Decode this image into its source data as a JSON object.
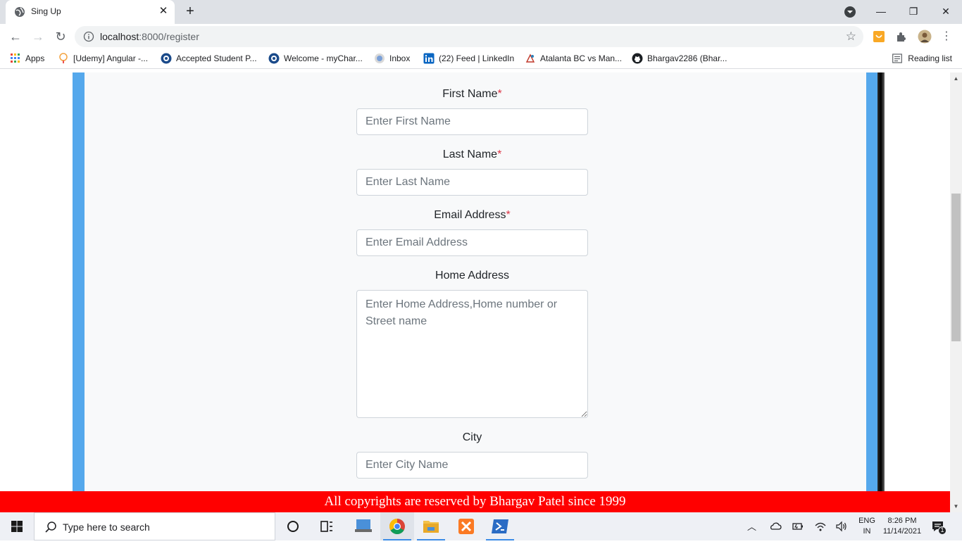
{
  "browser": {
    "tab_title": "Sing Up",
    "url_host": "localhost",
    "url_rest": ":8000/register",
    "bookmarks": [
      {
        "label": "Apps",
        "icon": "apps-grid-icon"
      },
      {
        "label": "[Udemy] Angular -...",
        "icon": "udemy-icon"
      },
      {
        "label": "Accepted Student P...",
        "icon": "charusat-icon"
      },
      {
        "label": "Welcome - myChar...",
        "icon": "charusat-icon"
      },
      {
        "label": "Inbox",
        "icon": "mail-icon"
      },
      {
        "label": "(22) Feed | LinkedIn",
        "icon": "linkedin-icon"
      },
      {
        "label": "Atalanta BC vs Man...",
        "icon": "football-icon"
      },
      {
        "label": "Bhargav2286 (Bhar...",
        "icon": "github-icon"
      }
    ],
    "reading_list": "Reading list"
  },
  "form": {
    "first_name": {
      "label": "First Name",
      "required_mark": "*",
      "placeholder": "Enter First Name"
    },
    "last_name": {
      "label": "Last Name",
      "required_mark": "*",
      "placeholder": "Enter Last Name"
    },
    "email": {
      "label": "Email Address",
      "required_mark": "*",
      "placeholder": "Enter Email Address"
    },
    "home_address": {
      "label": "Home Address",
      "placeholder": "Enter Home Address,Home number or Street name"
    },
    "city": {
      "label": "City",
      "placeholder": "Enter City Name"
    }
  },
  "footer": {
    "text": "All copyrights are reserved by Bhargav Patel since 1999"
  },
  "taskbar": {
    "search_placeholder": "Type here to search",
    "lang_line1": "ENG",
    "lang_line2": "IN",
    "time": "8:26 PM",
    "date": "11/14/2021",
    "notification_count": "1"
  },
  "colors": {
    "card_border": "#55a8ec",
    "card_bg": "#f8f9fa",
    "footer_bg": "#ff0000",
    "required": "#dc3545"
  }
}
